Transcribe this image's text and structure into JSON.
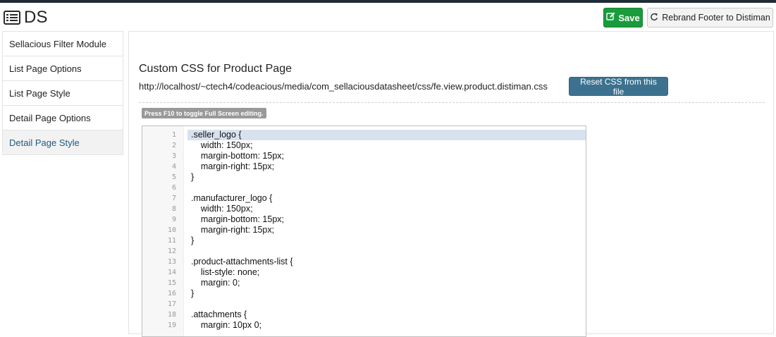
{
  "header": {
    "title": "DS",
    "save_label": "Save",
    "rebrand_label": "Rebrand Footer to Distiman"
  },
  "sidebar": {
    "items": [
      {
        "label": "Sellacious Filter Module"
      },
      {
        "label": "List Page Options"
      },
      {
        "label": "List Page Style"
      },
      {
        "label": "Detail Page Options"
      },
      {
        "label": "Detail Page Style",
        "active": true
      }
    ]
  },
  "panel": {
    "section_title": "Custom CSS for Product Page",
    "file_path": "http://localhost/~ctech4/codeacious/media/com_sellaciousdatasheet/css/fe.view.product.distiman.css",
    "reset_label": "Reset CSS from this file",
    "hint": "Press F10 to toggle Full Screen editing."
  },
  "editor": {
    "lines": [
      ".seller_logo {",
      "    width: 150px;",
      "    margin-bottom: 15px;",
      "    margin-right: 15px;",
      "}",
      "",
      ".manufacturer_logo {",
      "    width: 150px;",
      "    margin-bottom: 15px;",
      "    margin-right: 15px;",
      "}",
      "",
      ".product-attachments-list {",
      "    list-style: none;",
      "    margin: 0;",
      "}",
      "",
      ".attachments {",
      "    margin: 10px 0;"
    ]
  },
  "colors": {
    "save_bg": "#1a9b3c",
    "reset_bg": "#3c728f",
    "active_nav_text": "#1f5a80",
    "current_line_bg": "#d8e2ef"
  },
  "icons": {
    "app": "list-icon",
    "save": "edit-icon",
    "rebrand": "redo-icon"
  }
}
